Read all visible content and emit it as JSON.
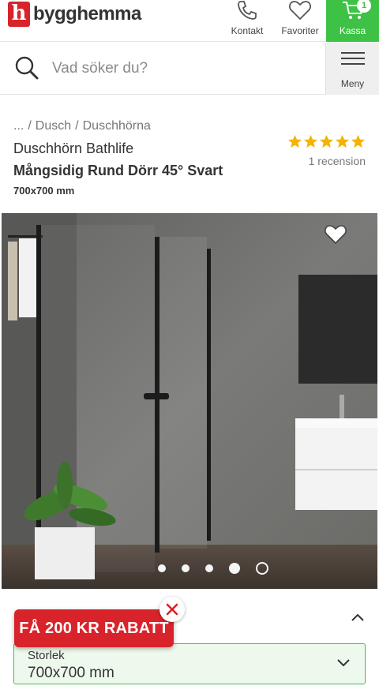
{
  "header": {
    "logo_mark": "h",
    "logo_text": "bygghemma",
    "kontakt_label": "Kontakt",
    "favoriter_label": "Favoriter",
    "kassa_label": "Kassa",
    "cart_count": "1"
  },
  "search": {
    "placeholder": "Vad söker du?",
    "menu_label": "Meny"
  },
  "product": {
    "breadcrumb": [
      "...",
      "Dusch",
      "Duschhörna"
    ],
    "brand": "Duschhörn Bathlife",
    "name": "Mångsidig Rund Dörr 45° Svart",
    "size": "700x700 mm",
    "rating": 5,
    "review_count": "1 recension"
  },
  "gallery": {
    "image_count": 5,
    "active_index": 4
  },
  "variant": {
    "label": "Storlek",
    "value": "700x700 mm"
  },
  "promo": {
    "text": "FÅ 200 KR RABATT"
  },
  "colors": {
    "brand_red": "#d8232a",
    "kassa_green": "#3dc245",
    "star": "#f5b400"
  }
}
